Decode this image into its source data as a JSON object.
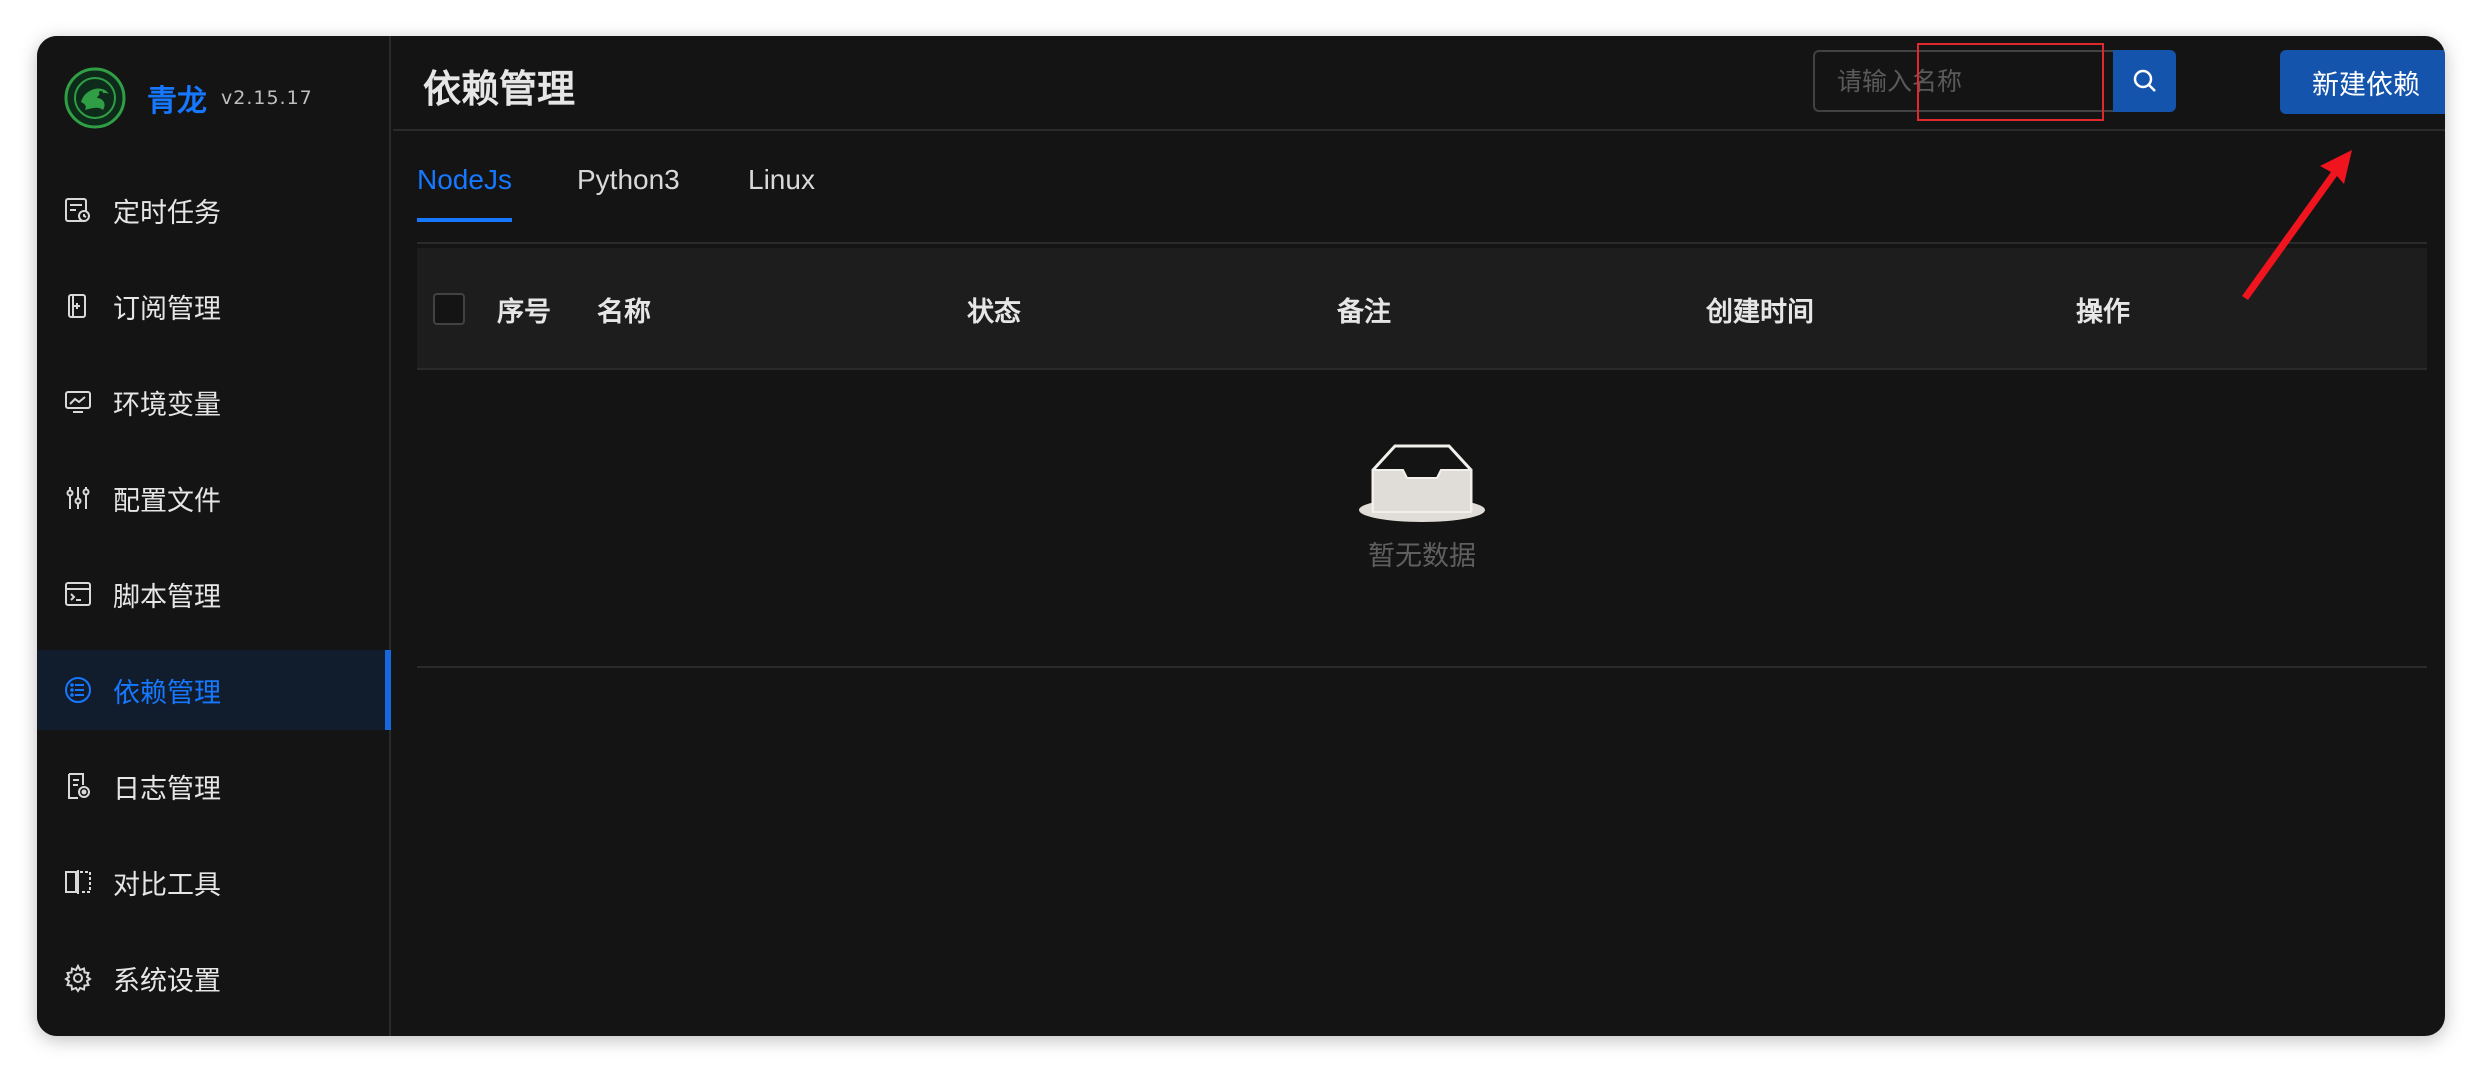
{
  "app": {
    "name": "青龙",
    "version": "v2.15.17"
  },
  "sidebar": {
    "items": [
      {
        "label": "定时任务",
        "icon": "calendar-clock-icon"
      },
      {
        "label": "订阅管理",
        "icon": "subscription-icon"
      },
      {
        "label": "环境变量",
        "icon": "monitor-icon"
      },
      {
        "label": "配置文件",
        "icon": "sliders-icon"
      },
      {
        "label": "脚本管理",
        "icon": "terminal-icon"
      },
      {
        "label": "依赖管理",
        "icon": "list-icon",
        "active": true
      },
      {
        "label": "日志管理",
        "icon": "log-file-icon"
      },
      {
        "label": "对比工具",
        "icon": "diff-icon"
      },
      {
        "label": "系统设置",
        "icon": "gear-icon"
      }
    ]
  },
  "header": {
    "title": "依赖管理",
    "search_placeholder": "请输入名称",
    "new_button": "新建依赖"
  },
  "tabs": [
    "NodeJs",
    "Python3",
    "Linux"
  ],
  "active_tab": "NodeJs",
  "table": {
    "columns": [
      "序号",
      "名称",
      "状态",
      "备注",
      "创建时间",
      "操作"
    ],
    "rows": [],
    "empty_text": "暂无数据"
  },
  "colors": {
    "accent": "#1677ff",
    "button": "#1554ad",
    "background": "#141414",
    "annotation": "#e0282f"
  }
}
